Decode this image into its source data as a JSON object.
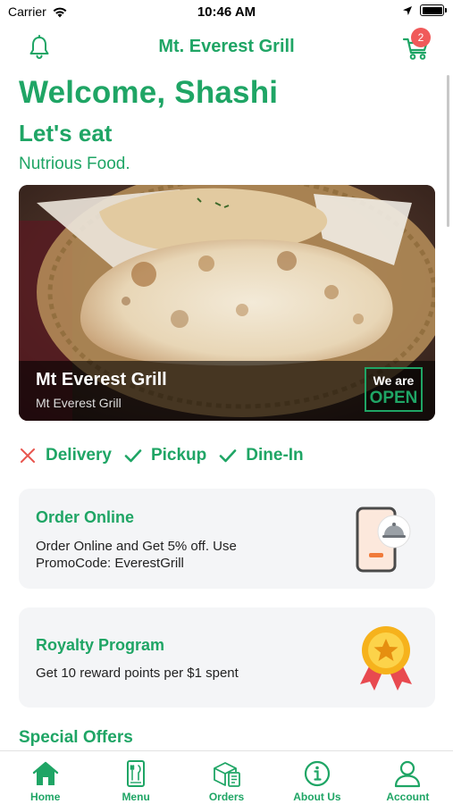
{
  "status_bar": {
    "carrier": "Carrier",
    "time": "10:46 AM"
  },
  "header": {
    "title": "Mt. Everest Grill",
    "cart_count": "2"
  },
  "welcome": {
    "greeting": "Welcome, Shashi",
    "headline": "Let's eat",
    "tagline": "Nutrious Food."
  },
  "hero": {
    "name": "Mt Everest Grill",
    "subtitle": "Mt Everest Grill",
    "status_top": "We are",
    "status_bottom": "OPEN"
  },
  "services": [
    {
      "label": "Delivery",
      "icon": "x-icon",
      "available": false
    },
    {
      "label": "Pickup",
      "icon": "check-icon",
      "available": true
    },
    {
      "label": "Dine-In",
      "icon": "check-icon",
      "available": true
    }
  ],
  "cards": {
    "order_online": {
      "title": "Order Online",
      "body": "Order Online and Get 5% off. Use PromoCode: EverestGrill",
      "icon": "phone-cloche-icon"
    },
    "loyalty": {
      "title": "Royalty Program",
      "body": "Get 10 reward points per $1 spent",
      "icon": "medal-icon"
    }
  },
  "special_offers": {
    "title": "Special Offers"
  },
  "tabs": [
    {
      "label": "Home",
      "icon": "home-icon"
    },
    {
      "label": "Menu",
      "icon": "menu-icon"
    },
    {
      "label": "Orders",
      "icon": "orders-icon"
    },
    {
      "label": "About Us",
      "icon": "info-icon"
    },
    {
      "label": "Account",
      "icon": "account-icon"
    }
  ],
  "colors": {
    "accent": "#1fa565",
    "badge": "#f05a5a",
    "card_bg": "#f4f5f7",
    "cross": "#e8554e"
  }
}
